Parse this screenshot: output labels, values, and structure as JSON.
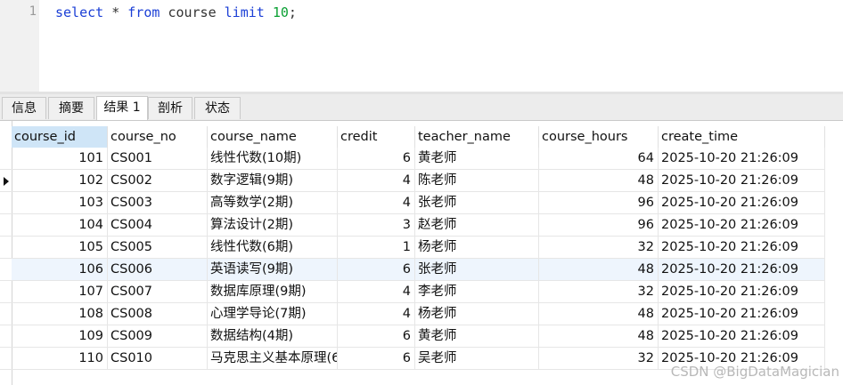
{
  "editor": {
    "line_number": "1",
    "sql": {
      "select": "select",
      "star": "*",
      "from": "from",
      "table": "course",
      "limit": "limit",
      "count": "10",
      "semicolon": ";"
    }
  },
  "tabs": [
    {
      "label": "信息",
      "active": false
    },
    {
      "label": "摘要",
      "active": false
    },
    {
      "label": "结果 1",
      "active": true
    },
    {
      "label": "剖析",
      "active": false
    },
    {
      "label": "状态",
      "active": false
    }
  ],
  "table": {
    "columns": [
      "course_id",
      "course_no",
      "course_name",
      "credit",
      "teacher_name",
      "course_hours",
      "create_time"
    ],
    "selected_column": "course_id",
    "current_row": 1,
    "highlighted_row": 5,
    "rows": [
      [
        "101",
        "CS001",
        "线性代数(10期)",
        "6",
        "黄老师",
        "64",
        "2025-10-20 21:26:09"
      ],
      [
        "102",
        "CS002",
        "数字逻辑(9期)",
        "4",
        "陈老师",
        "48",
        "2025-10-20 21:26:09"
      ],
      [
        "103",
        "CS003",
        "高等数学(2期)",
        "4",
        "张老师",
        "96",
        "2025-10-20 21:26:09"
      ],
      [
        "104",
        "CS004",
        "算法设计(2期)",
        "3",
        "赵老师",
        "96",
        "2025-10-20 21:26:09"
      ],
      [
        "105",
        "CS005",
        "线性代数(6期)",
        "1",
        "杨老师",
        "32",
        "2025-10-20 21:26:09"
      ],
      [
        "106",
        "CS006",
        "英语读写(9期)",
        "6",
        "张老师",
        "48",
        "2025-10-20 21:26:09"
      ],
      [
        "107",
        "CS007",
        "数据库原理(9期)",
        "4",
        "李老师",
        "32",
        "2025-10-20 21:26:09"
      ],
      [
        "108",
        "CS008",
        "心理学导论(7期)",
        "4",
        "杨老师",
        "48",
        "2025-10-20 21:26:09"
      ],
      [
        "109",
        "CS009",
        "数据结构(4期)",
        "6",
        "黄老师",
        "48",
        "2025-10-20 21:26:09"
      ],
      [
        "110",
        "CS010",
        "马克思主义基本原理(6",
        "6",
        "吴老师",
        "32",
        "2025-10-20 21:26:09"
      ]
    ]
  },
  "watermark": "CSDN @BigDataMagician",
  "colors": {
    "keyword": "#1b3fd6",
    "number": "#0aa033",
    "selected_header": "#cfe5f7",
    "highlight_row": "#eef5fd"
  }
}
